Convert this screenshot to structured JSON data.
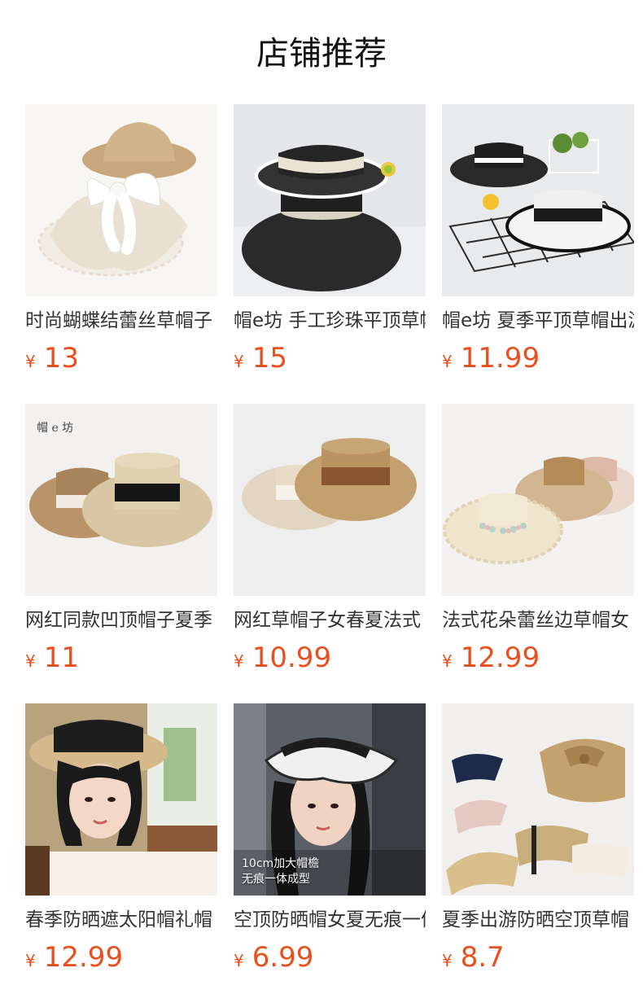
{
  "page": {
    "title": "店铺推荐"
  },
  "colors": {
    "price": "#e8501e",
    "text": "#333333",
    "title": "#111111"
  },
  "products": [
    {
      "name": "时尚蝴蝶结蕾丝草帽子",
      "currency": "¥",
      "price": "13",
      "image": "lace-bow-straw-hat-image",
      "overlay": ""
    },
    {
      "name": "帽e坊 手工珍珠平顶草帽",
      "currency": "¥",
      "price": "15",
      "image": "black-pearl-boater-hat-image",
      "overlay": ""
    },
    {
      "name": "帽e坊 夏季平顶草帽出游",
      "currency": "¥",
      "price": "11.99",
      "image": "black-white-boater-hats-image",
      "overlay": ""
    },
    {
      "name": "网红同款凹顶帽子夏季",
      "currency": "¥",
      "price": "11",
      "image": "beige-boater-hats-black-ribbon-image",
      "overlay": ""
    },
    {
      "name": "网红草帽子女春夏法式",
      "currency": "¥",
      "price": "10.99",
      "image": "brown-and-cream-boater-hats-image",
      "overlay": ""
    },
    {
      "name": "法式花朵蕾丝边草帽女",
      "currency": "¥",
      "price": "12.99",
      "image": "floral-lace-straw-hats-image",
      "overlay": ""
    },
    {
      "name": "春季防晒遮太阳帽礼帽",
      "currency": "¥",
      "price": "12.99",
      "image": "woman-wearing-straw-hat-image",
      "overlay": ""
    },
    {
      "name": "空顶防晒帽女夏无痕一体",
      "currency": "¥",
      "price": "6.99",
      "image": "woman-wearing-visor-image",
      "overlay": "10cm加大帽檐\n无痕一体成型"
    },
    {
      "name": "夏季出游防晒空顶草帽",
      "currency": "¥",
      "price": "8.7",
      "image": "foldable-straw-visors-image",
      "overlay": ""
    }
  ]
}
